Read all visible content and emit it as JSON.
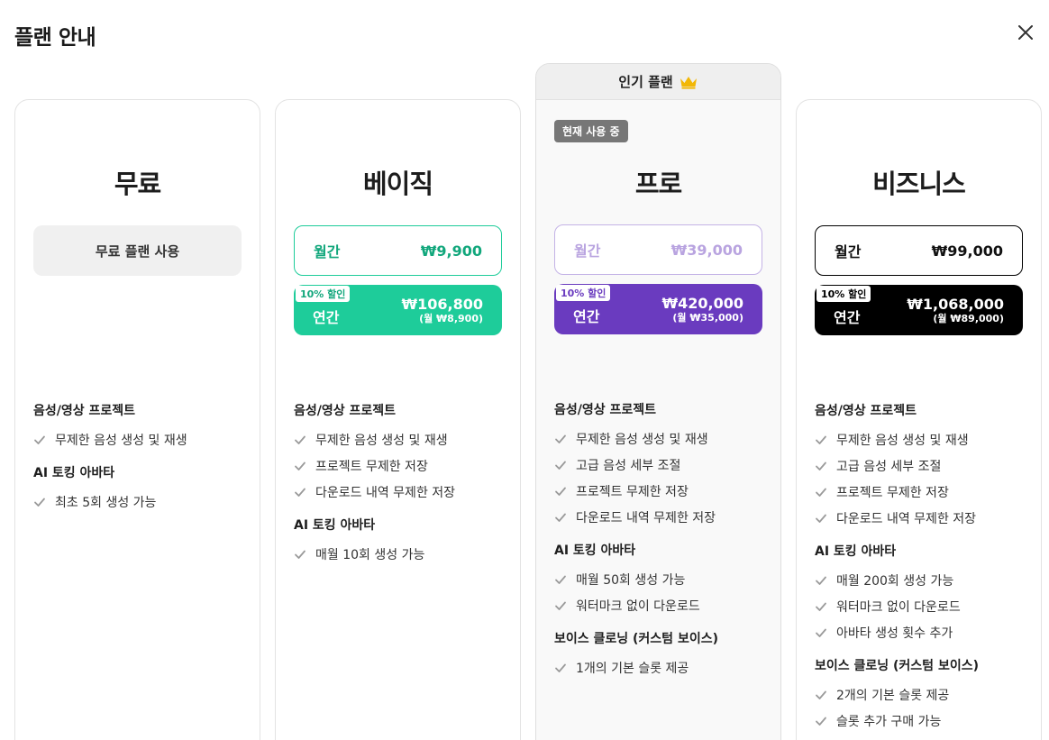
{
  "modal": {
    "title": "플랜 안내",
    "close_icon": "close-icon"
  },
  "colors": {
    "basic": "#1ecc9a",
    "basic_text": "#12a77c",
    "pro": "#6a3bbf",
    "pro_light": "#b9a4e0",
    "business": "#000000",
    "check": "#9a9a9a"
  },
  "plans": {
    "free": {
      "name": "무료",
      "cta": "무료 플랜 사용",
      "groups": [
        {
          "title": "음성/영상 프로젝트",
          "items": [
            "무제한 음성 생성 및 재생"
          ]
        },
        {
          "title": "AI 토킹 아바타",
          "items": [
            "최초 5회 생성 가능"
          ]
        }
      ]
    },
    "basic": {
      "name": "베이직",
      "monthly": {
        "label": "월간",
        "price": "₩9,900"
      },
      "yearly": {
        "badge": "10% 할인",
        "label": "연간",
        "price": "₩106,800",
        "sub": "(월 ₩8,900)"
      },
      "groups": [
        {
          "title": "음성/영상 프로젝트",
          "items": [
            "무제한 음성 생성 및 재생",
            "프로젝트 무제한 저장",
            "다운로드 내역 무제한 저장"
          ]
        },
        {
          "title": "AI 토킹 아바타",
          "items": [
            "매월 10회 생성 가능"
          ]
        }
      ]
    },
    "pro": {
      "banner": "인기 플랜",
      "banner_icon": "crown-icon",
      "current": "현재 사용 중",
      "name": "프로",
      "monthly": {
        "label": "월간",
        "price": "₩39,000"
      },
      "yearly": {
        "badge": "10% 할인",
        "label": "연간",
        "price": "₩420,000",
        "sub": "(월 ₩35,000)"
      },
      "groups": [
        {
          "title": "음성/영상 프로젝트",
          "items": [
            "무제한 음성 생성 및 재생",
            "고급 음성 세부 조절",
            "프로젝트 무제한 저장",
            "다운로드 내역 무제한 저장"
          ]
        },
        {
          "title": "AI 토킹 아바타",
          "items": [
            "매월 50회 생성 가능",
            "워터마크 없이 다운로드"
          ]
        },
        {
          "title": "보이스 클로닝 (커스텀 보이스)",
          "items": [
            "1개의 기본 슬롯 제공"
          ]
        }
      ]
    },
    "business": {
      "name": "비즈니스",
      "monthly": {
        "label": "월간",
        "price": "₩99,000"
      },
      "yearly": {
        "badge": "10% 할인",
        "label": "연간",
        "price": "₩1,068,000",
        "sub": "(월 ₩89,000)"
      },
      "groups": [
        {
          "title": "음성/영상 프로젝트",
          "items": [
            "무제한 음성 생성 및 재생",
            "고급 음성 세부 조절",
            "프로젝트 무제한 저장",
            "다운로드 내역 무제한 저장"
          ]
        },
        {
          "title": "AI 토킹 아바타",
          "items": [
            "매월 200회 생성 가능",
            "워터마크 없이 다운로드",
            "아바타 생성 횟수 추가"
          ]
        },
        {
          "title": "보이스 클로닝 (커스텀 보이스)",
          "items": [
            "2개의 기본 슬롯 제공",
            "슬롯 추가 구매 가능"
          ]
        }
      ]
    }
  }
}
